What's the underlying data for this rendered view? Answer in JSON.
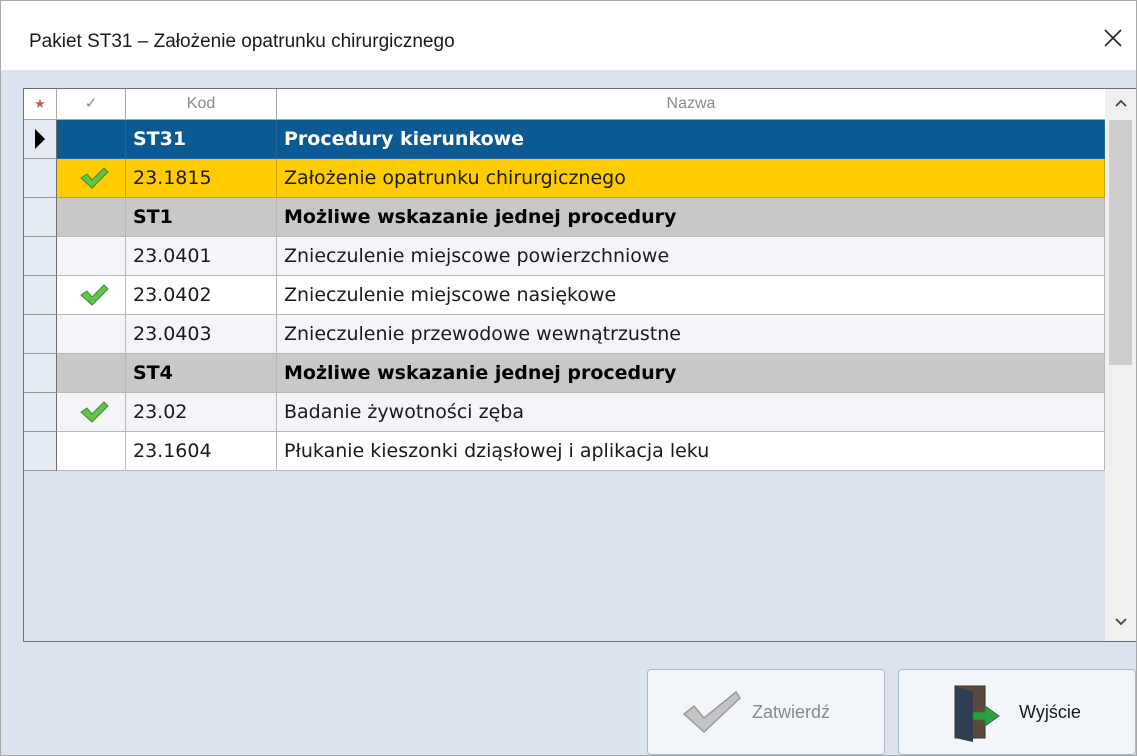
{
  "window": {
    "title": "Pakiet ST31 – Założenie opatrunku chirurgicznego"
  },
  "grid": {
    "header": {
      "star": "★",
      "check": "✓",
      "kod": "Kod",
      "nazwa": "Nazwa"
    },
    "rows": [
      {
        "kod": "ST31",
        "nazwa": "Procedury kierunkowe",
        "checked": false,
        "type": "selected"
      },
      {
        "kod": "23.1815",
        "nazwa": "Założenie opatrunku chirurgicznego",
        "checked": true,
        "type": "highlight"
      },
      {
        "kod": "ST1",
        "nazwa": "Możliwe wskazanie jednej procedury",
        "checked": false,
        "type": "group"
      },
      {
        "kod": "23.0401",
        "nazwa": "Znieczulenie miejscowe powierzchniowe",
        "checked": false,
        "type": "alt"
      },
      {
        "kod": "23.0402",
        "nazwa": "Znieczulenie miejscowe nasiękowe",
        "checked": true,
        "type": "normal"
      },
      {
        "kod": "23.0403",
        "nazwa": "Znieczulenie przewodowe wewnątrzustne",
        "checked": false,
        "type": "alt"
      },
      {
        "kod": "ST4",
        "nazwa": "Możliwe wskazanie jednej procedury",
        "checked": false,
        "type": "group"
      },
      {
        "kod": "23.02",
        "nazwa": "Badanie żywotności zęba",
        "checked": true,
        "type": "alt"
      },
      {
        "kod": "23.1604",
        "nazwa": "Płukanie kieszonki dziąsłowej i aplikacja leku",
        "checked": false,
        "type": "normal"
      }
    ]
  },
  "buttons": {
    "confirm": "Zatwierdź",
    "exit": "Wyjście"
  },
  "colors": {
    "selected_row": "#0b5a94",
    "highlight_row": "#ffcc00",
    "group_row": "#c8c8c8",
    "background": "#dbe3ef"
  },
  "icons": {
    "close": "close-icon",
    "check": "check-icon",
    "exit": "exit-door-icon"
  }
}
